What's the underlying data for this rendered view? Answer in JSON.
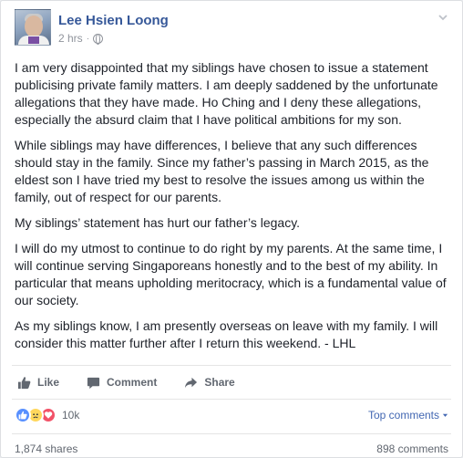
{
  "post": {
    "author": "Lee Hsien Loong",
    "time": "2 hrs",
    "privacy_icon": "globe-icon",
    "paragraphs": [
      "I am very disappointed that my siblings have chosen to issue a statement publicising private family matters. I am deeply saddened by the unfortunate allegations that they have made. Ho Ching and I deny these allegations, especially the absurd claim that I have political ambitions for my son.",
      "While siblings may have differences, I believe that any such differences should stay in the family. Since my father’s passing in March 2015, as the eldest son I have tried my best to resolve the issues among us within the family, out of respect for our parents.",
      "My siblings’ statement has hurt our father’s legacy.",
      "I will do my utmost to continue to do right by my parents. At the same time, I will continue serving Singaporeans honestly and to the best of my ability. In particular that means upholding meritocracy, which is a fundamental value of our society.",
      "As my siblings know, I am presently overseas on leave with my family. I will consider this matter further after I return this weekend. - LHL"
    ]
  },
  "actions": {
    "like": "Like",
    "comment": "Comment",
    "share": "Share"
  },
  "footer": {
    "reactions": [
      "like",
      "sad",
      "love"
    ],
    "reaction_count": "10k",
    "top_comments": "Top comments",
    "shares": "1,874 shares",
    "comments": "898 comments"
  },
  "colors": {
    "link": "#365899",
    "meta": "#90949c",
    "like": "#5890ff",
    "love": "#f25268",
    "sad": "#ffd75c"
  }
}
